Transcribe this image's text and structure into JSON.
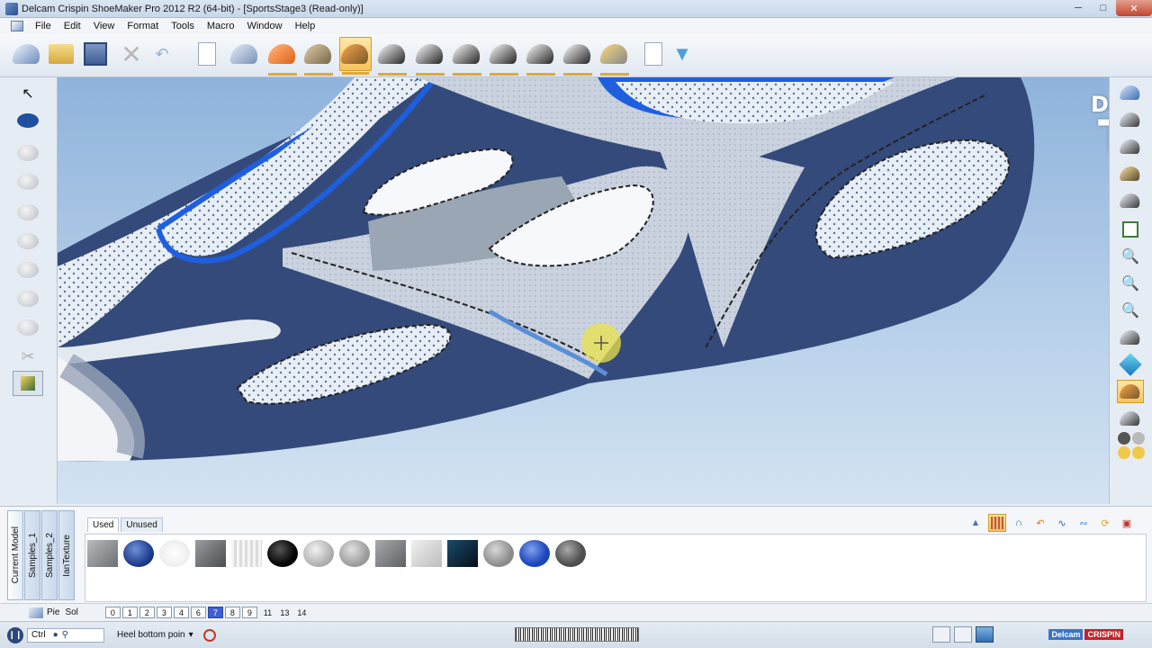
{
  "window": {
    "title": "Delcam Crispin ShoeMaker Pro 2012 R2 (64-bit) - [SportsStage3 (Read-only)]"
  },
  "menu": [
    "File",
    "Edit",
    "View",
    "Format",
    "Tools",
    "Macro",
    "Window",
    "Help"
  ],
  "watermark": {
    "line1": "Delcam",
    "line2": "TV"
  },
  "bottom_panel": {
    "vertical_tabs": [
      "Current Model",
      "Samples_1",
      "Samples_2",
      "IanTexture"
    ],
    "tabs": [
      "Used",
      "Unused"
    ],
    "swatch_colors": [
      "#8c8f93",
      "#1f3f8f",
      "#e6e6e6",
      "#6a6c70",
      "#dcdcdc",
      "#050505",
      "#a9a9a9",
      "#9a9a9a",
      "#7c7e82",
      "#d2d2d2",
      "#0c2a44",
      "#8a8a8a",
      "#1b45b8",
      "#4e4e4e"
    ]
  },
  "layers": {
    "labels": [
      "Pie",
      "Sol"
    ],
    "buttons": [
      "0",
      "1",
      "2",
      "3",
      "4",
      "6",
      "7",
      "8",
      "9"
    ],
    "plain": [
      "11",
      "13",
      "14"
    ],
    "active": "7"
  },
  "status": {
    "ctrl": "Ctrl",
    "heel_select": "Heel bottom poin",
    "brand_left": "Delcam",
    "brand_right": "CRISPIN"
  }
}
